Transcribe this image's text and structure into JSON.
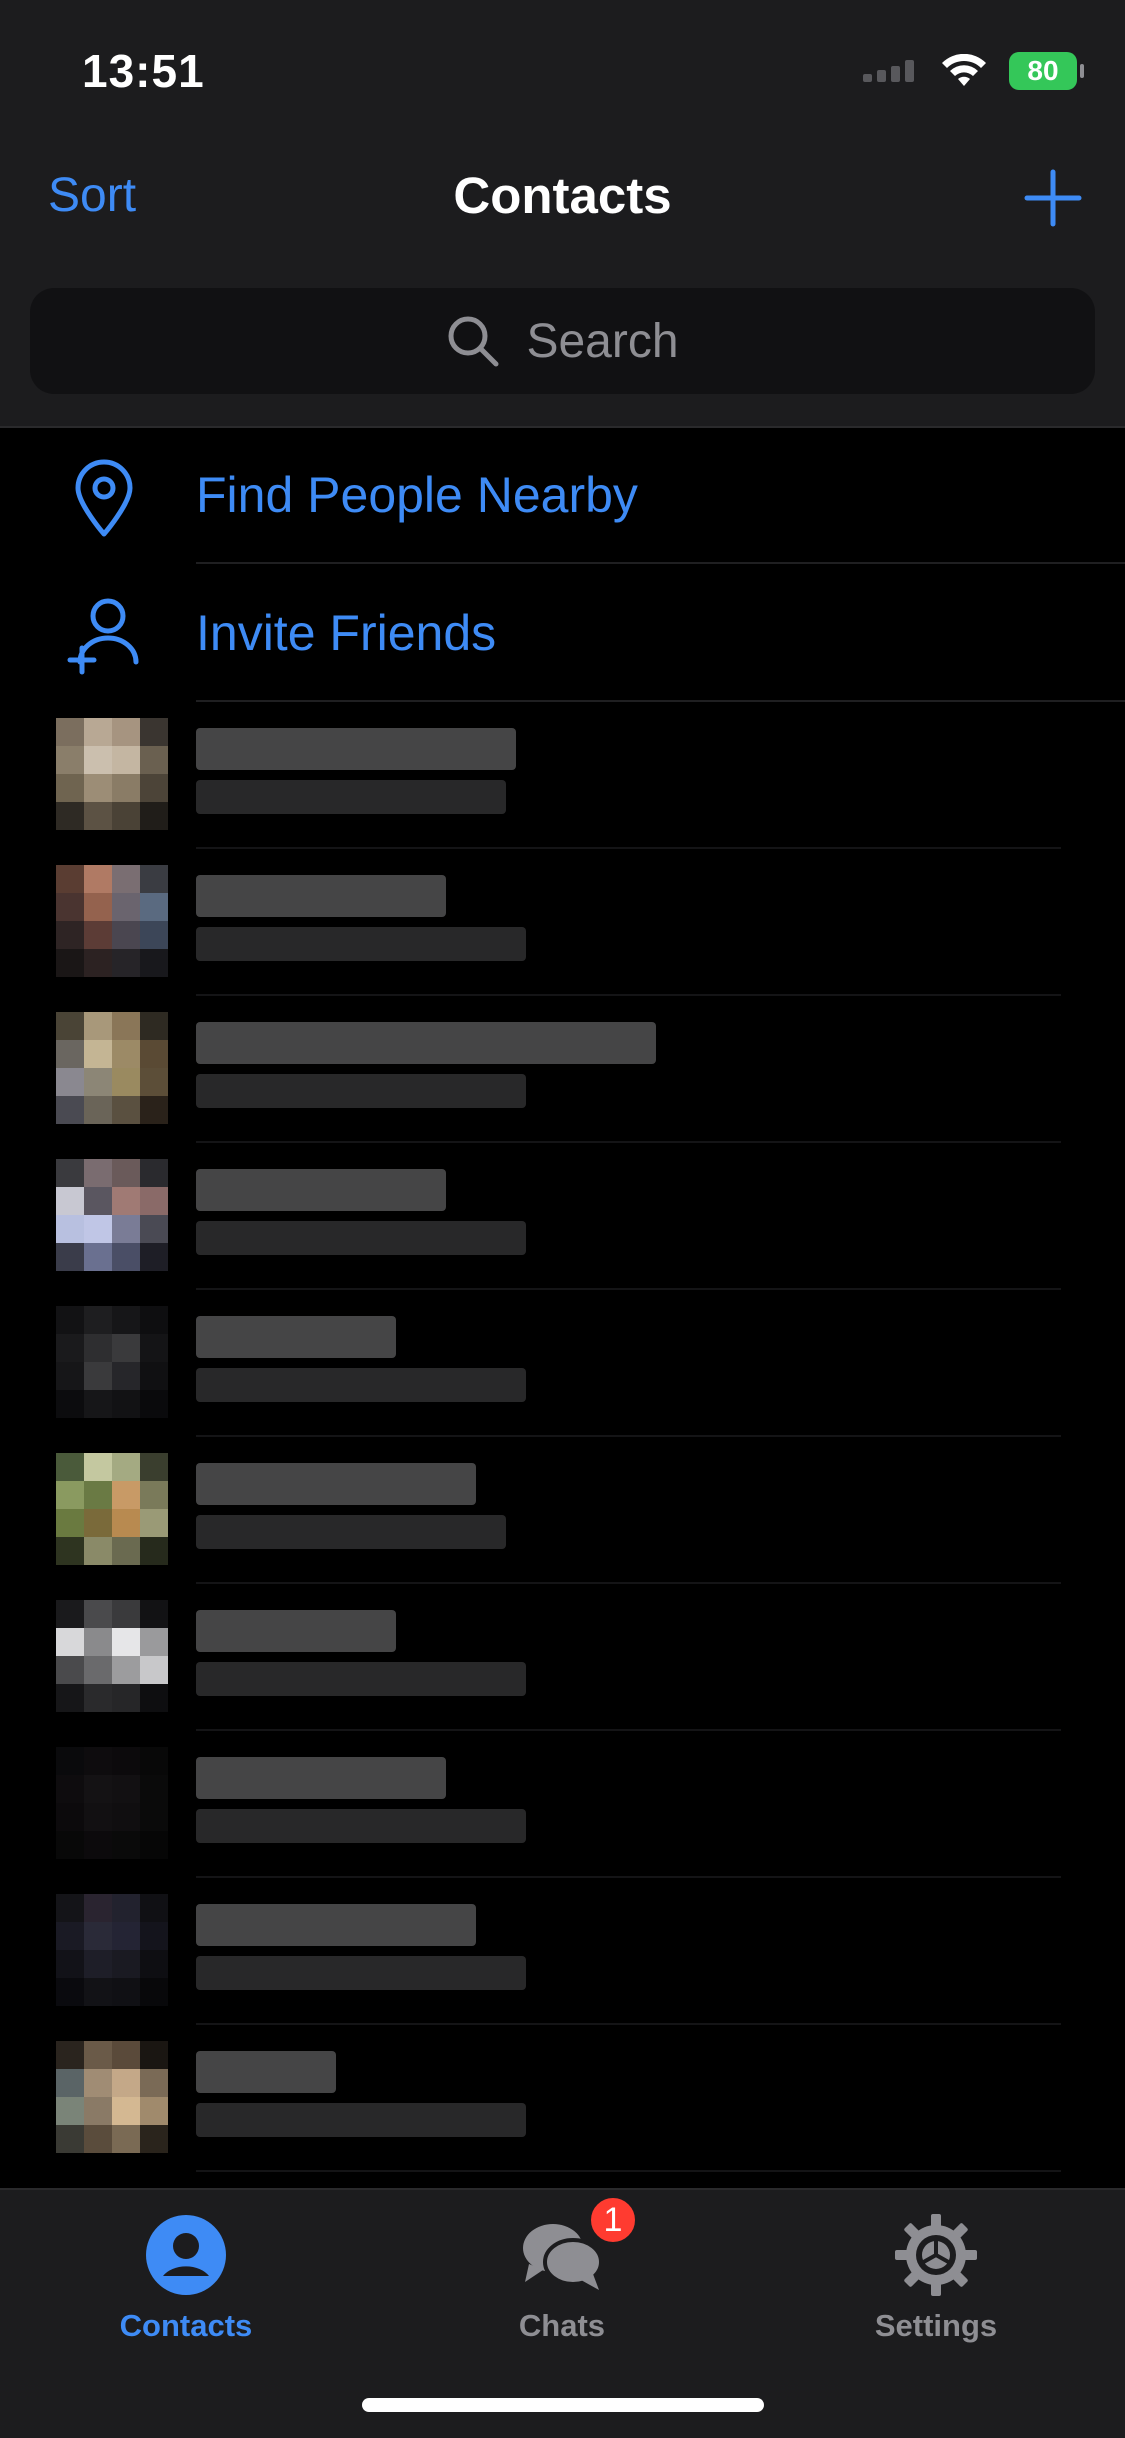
{
  "status_bar": {
    "time": "13:51",
    "battery": "80"
  },
  "nav": {
    "sort_label": "Sort",
    "title": "Contacts",
    "add_icon": "plus-icon"
  },
  "search": {
    "placeholder": "Search",
    "icon": "search-icon"
  },
  "actions": [
    {
      "label": "Find People Nearby",
      "icon": "location-pin-icon"
    },
    {
      "label": "Invite Friends",
      "icon": "add-person-icon"
    }
  ],
  "contacts_note": "contact names and avatars are pixelated/obscured in the screenshot",
  "tabs": [
    {
      "label": "Contacts",
      "icon": "person-circle-icon",
      "active": true
    },
    {
      "label": "Chats",
      "icon": "chat-bubbles-icon",
      "badge": "1"
    },
    {
      "label": "Settings",
      "icon": "gear-icon"
    }
  ],
  "colors": {
    "accent": "#3e8bf5",
    "background": "#000000",
    "bar_background": "#1c1c1e",
    "badge": "#ff3b30",
    "battery": "#34c759"
  }
}
